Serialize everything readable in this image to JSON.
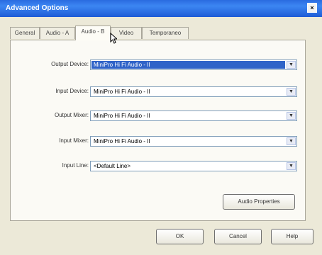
{
  "window": {
    "title": "Advanced Options",
    "close_glyph": "×"
  },
  "tabs": [
    {
      "label": "General",
      "active": false
    },
    {
      "label": "Audio - A",
      "active": false
    },
    {
      "label": "Audio - B",
      "active": true
    },
    {
      "label": "Video",
      "active": false
    },
    {
      "label": "Temporaneo",
      "active": false
    }
  ],
  "fields": [
    {
      "label": "Output Device:",
      "value": "MiniPro Hi Fi Audio - II",
      "selected": true
    },
    {
      "label": "Input Device:",
      "value": "MiniPro Hi Fi Audio - II",
      "selected": false
    },
    {
      "label": "Output Mixer:",
      "value": "MiniPro Hi Fi Audio - II",
      "selected": false
    },
    {
      "label": "Input Mixer:",
      "value": "MiniPro Hi Fi Audio - II",
      "selected": false
    },
    {
      "label": "Input Line:",
      "value": "<Default Line>",
      "selected": false
    }
  ],
  "buttons": {
    "audio_properties": "Audio Properties",
    "ok": "OK",
    "cancel": "Cancel",
    "help": "Help"
  },
  "icons": {
    "dropdown": "chevron-down-icon",
    "cursor": "mouse-pointer-icon"
  }
}
